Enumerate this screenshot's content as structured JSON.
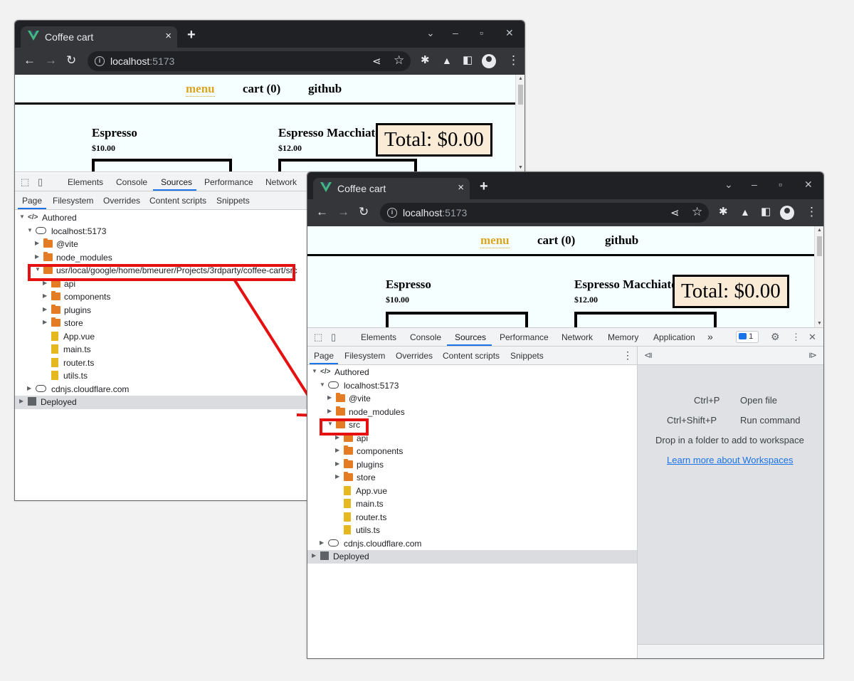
{
  "browser": {
    "tab_title": "Coffee cart",
    "tab_close": "×",
    "new_tab": "+",
    "window_controls": {
      "dropdown": "⌄",
      "minimize": "–",
      "maximize": "▫",
      "close": "✕"
    },
    "url_host": "localhost",
    "url_port": ":5173",
    "icons": [
      "back-arrow-icon",
      "forward-arrow-icon",
      "reload-icon",
      "info-icon",
      "share-icon",
      "star-icon",
      "extensions-icon",
      "labs-icon",
      "sidepanel-icon",
      "profile-icon",
      "kebab-menu-icon"
    ]
  },
  "app": {
    "nav": {
      "menu": "menu",
      "cart": "cart (0)",
      "github": "github"
    },
    "products": [
      {
        "name": "Espresso",
        "price": "$10.00"
      },
      {
        "name": "Espresso Macchiato",
        "price": "$12.00"
      }
    ],
    "total": "Total: $0.00"
  },
  "devtools": {
    "tabs_left": [
      "Elements",
      "Console",
      "Sources",
      "Performance",
      "Network"
    ],
    "tabs_right": [
      "Elements",
      "Console",
      "Sources",
      "Performance",
      "Network",
      "Memory",
      "Application"
    ],
    "more_tabs": "»",
    "issues_count": "1",
    "selected_tab": "Sources",
    "subtabs": [
      "Page",
      "Filesystem",
      "Overrides",
      "Content scripts",
      "Snippets"
    ],
    "tree_left": [
      {
        "label": "Authored",
        "depth": 0,
        "icon": "code",
        "arrow": "down"
      },
      {
        "label": "localhost:5173",
        "depth": 1,
        "icon": "cloud",
        "arrow": "down"
      },
      {
        "label": "@vite",
        "depth": 2,
        "icon": "folder",
        "arrow": "right"
      },
      {
        "label": "node_modules",
        "depth": 2,
        "icon": "folder",
        "arrow": "right"
      },
      {
        "label": "usr/local/google/home/bmeurer/Projects/3rdparty/coffee-cart/src",
        "depth": 2,
        "icon": "folder",
        "arrow": "down"
      },
      {
        "label": "api",
        "depth": 3,
        "icon": "folder",
        "arrow": "right"
      },
      {
        "label": "components",
        "depth": 3,
        "icon": "folder",
        "arrow": "right"
      },
      {
        "label": "plugins",
        "depth": 3,
        "icon": "folder",
        "arrow": "right"
      },
      {
        "label": "store",
        "depth": 3,
        "icon": "folder",
        "arrow": "right"
      },
      {
        "label": "App.vue",
        "depth": 3,
        "icon": "file",
        "arrow": ""
      },
      {
        "label": "main.ts",
        "depth": 3,
        "icon": "file",
        "arrow": ""
      },
      {
        "label": "router.ts",
        "depth": 3,
        "icon": "file",
        "arrow": ""
      },
      {
        "label": "utils.ts",
        "depth": 3,
        "icon": "file",
        "arrow": ""
      },
      {
        "label": "cdnjs.cloudflare.com",
        "depth": 1,
        "icon": "cloud",
        "arrow": "right"
      },
      {
        "label": "Deployed",
        "depth": 0,
        "icon": "cube",
        "arrow": "right"
      }
    ],
    "tree_right": [
      {
        "label": "Authored",
        "depth": 0,
        "icon": "code",
        "arrow": "down"
      },
      {
        "label": "localhost:5173",
        "depth": 1,
        "icon": "cloud",
        "arrow": "down"
      },
      {
        "label": "@vite",
        "depth": 2,
        "icon": "folder",
        "arrow": "right"
      },
      {
        "label": "node_modules",
        "depth": 2,
        "icon": "folder",
        "arrow": "right"
      },
      {
        "label": "src",
        "depth": 2,
        "icon": "folder",
        "arrow": "down"
      },
      {
        "label": "api",
        "depth": 3,
        "icon": "folder",
        "arrow": "right"
      },
      {
        "label": "components",
        "depth": 3,
        "icon": "folder",
        "arrow": "right"
      },
      {
        "label": "plugins",
        "depth": 3,
        "icon": "folder",
        "arrow": "right"
      },
      {
        "label": "store",
        "depth": 3,
        "icon": "folder",
        "arrow": "right"
      },
      {
        "label": "App.vue",
        "depth": 3,
        "icon": "file",
        "arrow": ""
      },
      {
        "label": "main.ts",
        "depth": 3,
        "icon": "file",
        "arrow": ""
      },
      {
        "label": "router.ts",
        "depth": 3,
        "icon": "file",
        "arrow": ""
      },
      {
        "label": "utils.ts",
        "depth": 3,
        "icon": "file",
        "arrow": ""
      },
      {
        "label": "cdnjs.cloudflare.com",
        "depth": 1,
        "icon": "cloud",
        "arrow": "right"
      },
      {
        "label": "Deployed",
        "depth": 0,
        "icon": "cube",
        "arrow": "right"
      }
    ],
    "shortcuts": [
      {
        "keys": "Ctrl+P",
        "action": "Open file"
      },
      {
        "keys": "Ctrl+Shift+P",
        "action": "Run command"
      }
    ],
    "drop_hint": "Drop in a folder to add to workspace",
    "workspace_link": "Learn more about Workspaces"
  },
  "colors": {
    "highlight": "#e61010",
    "nav_active": "#daa520",
    "total_bg": "#faebd7",
    "folder": "#e37c22",
    "file": "#e5b81f"
  }
}
